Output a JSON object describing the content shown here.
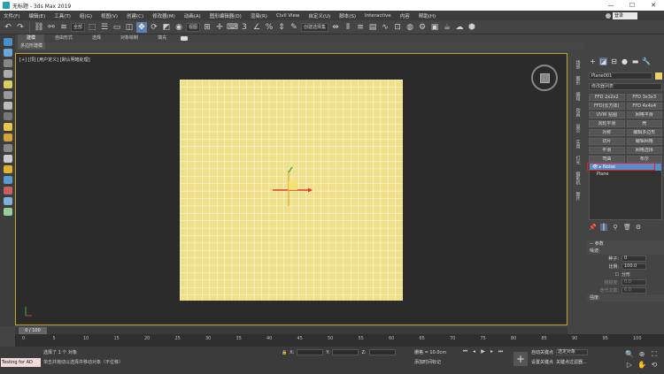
{
  "window": {
    "title": "无标题 - 3ds Max 2019",
    "minimize": "—",
    "maximize": "☐",
    "close": "✕"
  },
  "menu": {
    "items": [
      "文件(F)",
      "编辑(E)",
      "工具(T)",
      "组(G)",
      "视图(V)",
      "创建(C)",
      "修改器(M)",
      "动画(A)",
      "图形编辑器(D)",
      "渲染(R)",
      "Civil View",
      "自定义(U)",
      "脚本(S)",
      "Interactive",
      "内容",
      "帮助(H)"
    ],
    "user_label": "登录"
  },
  "toolbar": {
    "selection_filter": "全部",
    "ref_coord": "视图",
    "named_selection": "创建选择集"
  },
  "ribbon": {
    "tabs": [
      "建模",
      "自由形式",
      "选择",
      "对象绘制",
      "填充"
    ],
    "sub_label": "多边形建模"
  },
  "viewport": {
    "label": "[+] [顶] [用户定义] [默认明暗处理]",
    "plane_color": "#efe08c",
    "border_color": "#c8a530"
  },
  "command_panel": {
    "side_tabs": [
      "场景",
      "图形",
      "编辑",
      "动画",
      "显示",
      "实用",
      "灯光",
      "摄影机",
      "图片"
    ],
    "object_name": "Plane001",
    "modifier_list": "修改器列表",
    "mod_buttons": [
      "FFD 2x2x2",
      "FFD 3x3x3",
      "FFD(长方体)",
      "FFD 4x4x4",
      "UVW 贴图",
      "网格平滑",
      "涡轮平滑",
      "壳",
      "对称",
      "编辑多边形",
      "切片",
      "编辑网格",
      "平滑",
      "网格选择",
      "弯曲",
      "布尔"
    ],
    "stack": [
      "Noise",
      "Plane"
    ],
    "rollout_title": "参数",
    "noise_section": "噪波:",
    "seed_label": "种子:",
    "seed_value": "0",
    "scale_label": "比例:",
    "scale_value": "100.0",
    "fractal_label": "分形",
    "roughness_label": "粗糙度:",
    "roughness_value": "0.0",
    "iterations_label": "迭代次数:",
    "iterations_value": "6.0",
    "strength_section": "强度:"
  },
  "timeline": {
    "slider_label": "0 / 100",
    "ticks": [
      "0",
      "5",
      "10",
      "15",
      "20",
      "25",
      "30",
      "35",
      "40",
      "45",
      "50",
      "55",
      "60",
      "65",
      "70",
      "75",
      "80",
      "85",
      "90",
      "95",
      "100"
    ]
  },
  "status": {
    "maxscript": "Testing for AD",
    "selected": "选择了 1 个 对象",
    "hint": "单击并拖动以选择并移动对象（不位移）",
    "x_label": "X:",
    "y_label": "Y:",
    "z_label": "Z:",
    "grid": "栅格 = 10.0cm",
    "add_time_tag": "添加时间标记",
    "auto_key": "自动关键点",
    "selection_set": "选定对象",
    "set_key": "设置关键点",
    "key_filters": "关键点过滤器..."
  }
}
